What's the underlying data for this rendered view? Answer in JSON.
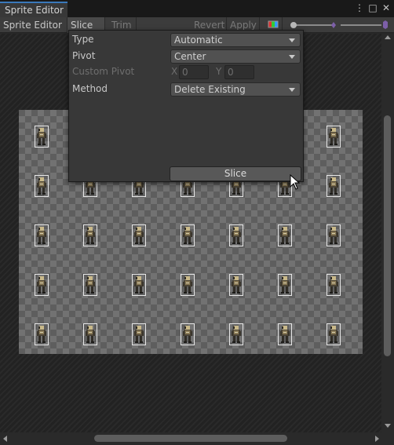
{
  "window": {
    "title": "Sprite Editor"
  },
  "toolbar": {
    "editor_mode": "Sprite Editor",
    "slice": "Slice",
    "trim": "Trim",
    "revert": "Revert",
    "apply": "Apply"
  },
  "popup": {
    "type_label": "Type",
    "type_value": "Automatic",
    "pivot_label": "Pivot",
    "pivot_value": "Center",
    "custom_pivot_label": "Custom Pivot",
    "x_label": "X",
    "x_value": "0",
    "y_label": "Y",
    "y_value": "0",
    "method_label": "Method",
    "method_value": "Delete Existing",
    "slice_button": "Slice"
  },
  "sprites": {
    "rows": 5,
    "columns": 7
  },
  "colors": {
    "accent": "#3a79bb",
    "background": "#282828",
    "panel": "#383838"
  }
}
